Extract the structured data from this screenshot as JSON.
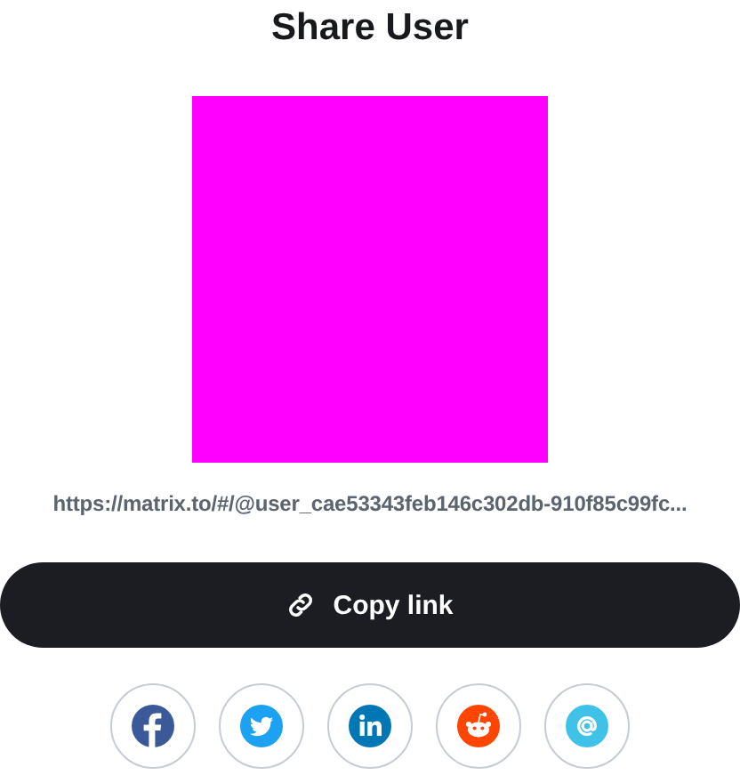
{
  "title": "Share User",
  "qr": {
    "kind": "placeholder",
    "color": "#ff00ff"
  },
  "link": "https://matrix.to/#/@user_cae53343feb146c302db-910f85c99fc...",
  "copy_button": {
    "label": "Copy link"
  },
  "share_buttons": [
    {
      "kind": "facebook"
    },
    {
      "kind": "twitter"
    },
    {
      "kind": "linkedin"
    },
    {
      "kind": "reddit"
    },
    {
      "kind": "email"
    }
  ]
}
